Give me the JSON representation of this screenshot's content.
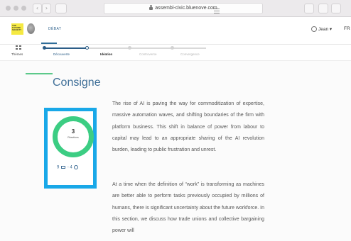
{
  "browser": {
    "url": "assembl-civic.bluenove.com",
    "back_glyph": "‹",
    "forward_glyph": "›",
    "reload_glyph": "↻"
  },
  "header": {
    "logo_text": "THE FUTURE SOCIETY",
    "nav_tab": "DÉBAT",
    "user": "Jean ▾",
    "lang": "FR"
  },
  "phases": {
    "themes_label": "Thèmes",
    "items": [
      {
        "label": "Découverte",
        "state": "done"
      },
      {
        "label": "Idéation",
        "state": "current"
      },
      {
        "label": "Controverse",
        "state": "upcoming"
      },
      {
        "label": "Convergence",
        "state": "upcoming"
      }
    ]
  },
  "main": {
    "title": "Consigne",
    "stats": {
      "count": "3",
      "count_label": "Réactions",
      "messages": "9",
      "separator": "-",
      "participants": "4"
    },
    "paragraphs": [
      "The rise of AI is paving the way for commoditization of expertise, massive automation waves, and shifting boundaries of the firm with platform business. This shift in balance of power from labour to capital may lead to an appropriate sharing of the AI revolution burden, leading to public frustration and unrest.",
      "At a time when the definition of “work” is transforming as machines are better able to perform tasks previously occupied by millions of humans, there is significant uncertainty about the future workforce. In this section, we discuss how trade unions and collective bargaining power will"
    ]
  },
  "colors": {
    "accent_green": "#3ccd83",
    "brand_blue": "#3f6f98",
    "highlight": "#19a8e8"
  }
}
